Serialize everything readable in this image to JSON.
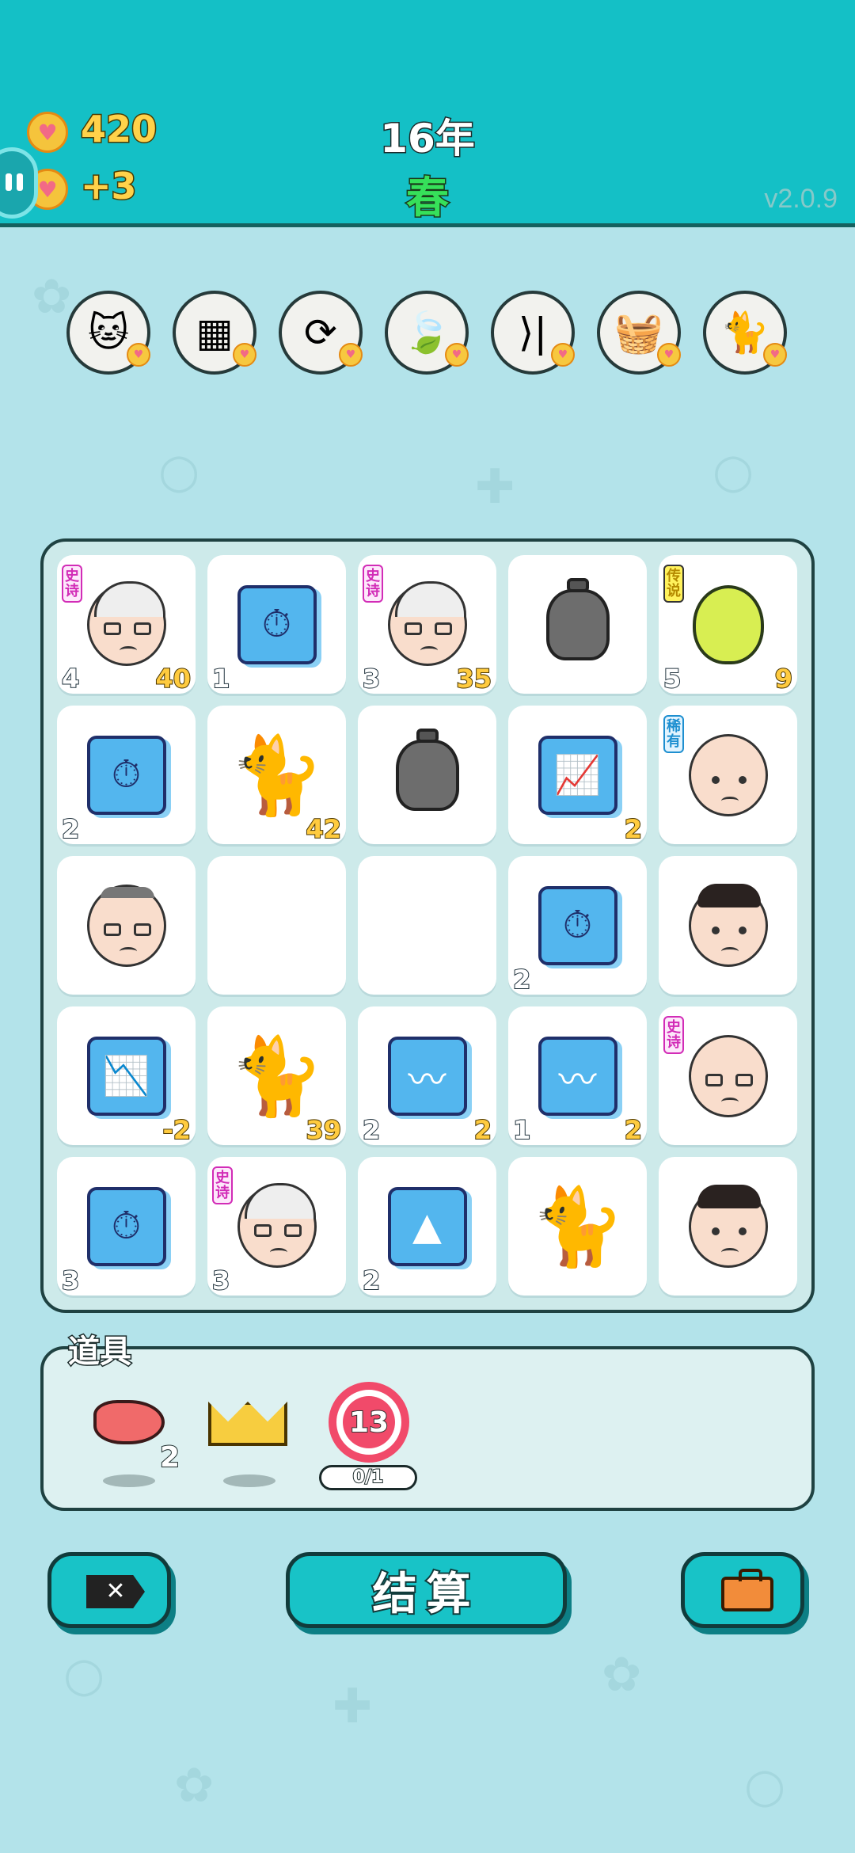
{
  "header": {
    "coins": "420",
    "income": "+3",
    "year": "16年",
    "season": "春",
    "version": "v2.0.9"
  },
  "skills": [
    {
      "icon": "cats-icon",
      "glyph": "🐱"
    },
    {
      "icon": "blocks-icon",
      "glyph": "▦"
    },
    {
      "icon": "refresh-icon",
      "glyph": "⟳"
    },
    {
      "icon": "leaf-icon",
      "glyph": "🍃"
    },
    {
      "icon": "skip-icon",
      "glyph": "⟩|"
    },
    {
      "icon": "basket-icon",
      "glyph": "🧺"
    },
    {
      "icon": "cat-head-icon",
      "glyph": "🐈"
    }
  ],
  "board": [
    [
      {
        "type": "face-white",
        "tag": "史诗",
        "tagType": "epic",
        "bl": "4",
        "br": "40"
      },
      {
        "type": "timer",
        "bl": "1",
        "br": ""
      },
      {
        "type": "face-white",
        "tag": "史诗",
        "tagType": "epic",
        "bl": "3",
        "br": "35"
      },
      {
        "type": "bag",
        "bl": "",
        "br": ""
      },
      {
        "type": "pear",
        "tag": "传说",
        "tagType": "legend",
        "bl": "5",
        "br": "9"
      }
    ],
    [
      {
        "type": "timer",
        "bl": "2",
        "br": ""
      },
      {
        "type": "cat",
        "bl": "",
        "br": "42"
      },
      {
        "type": "bag",
        "bl": "",
        "br": ""
      },
      {
        "type": "chart-up",
        "bl": "",
        "br": "2"
      },
      {
        "type": "face-bald",
        "tag": "稀有",
        "tagType": "rare",
        "bl": "",
        "br": ""
      }
    ],
    [
      {
        "type": "face-grey",
        "bl": "",
        "br": ""
      },
      {
        "type": "empty",
        "bl": "",
        "br": ""
      },
      {
        "type": "empty",
        "bl": "",
        "br": ""
      },
      {
        "type": "timer",
        "bl": "2",
        "br": ""
      },
      {
        "type": "face-black",
        "bl": "",
        "br": ""
      }
    ],
    [
      {
        "type": "chart-down",
        "bl": "",
        "br": "-2"
      },
      {
        "type": "cat",
        "bl": "",
        "br": "39"
      },
      {
        "type": "trend",
        "bl": "2",
        "br": "2"
      },
      {
        "type": "trend",
        "bl": "1",
        "br": "2"
      },
      {
        "type": "face-bald",
        "tag": "史诗",
        "tagType": "epic",
        "bl": "",
        "br": ""
      }
    ],
    [
      {
        "type": "timer",
        "bl": "3",
        "br": ""
      },
      {
        "type": "face-white",
        "tag": "史诗",
        "tagType": "epic",
        "bl": "3",
        "br": ""
      },
      {
        "type": "gold",
        "bl": "2",
        "br": ""
      },
      {
        "type": "cat",
        "bl": "",
        "br": ""
      },
      {
        "type": "face-black",
        "bl": "",
        "br": ""
      }
    ]
  ],
  "items": {
    "label": "道具",
    "liver_count": "2",
    "dart_value": "13",
    "dart_progress": "0/1"
  },
  "buttons": {
    "close": "✕",
    "settle": "结算"
  },
  "colors": {
    "header": "#14c0c6",
    "background": "#b3e3ea",
    "accent": "#18c3c7"
  }
}
